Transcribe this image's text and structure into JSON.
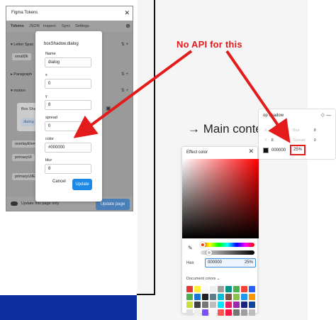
{
  "plugin": {
    "title": "Figma Tokens",
    "close_glyph": "✕",
    "tabs": [
      "Tokens",
      "JSON",
      "Inspect",
      "Sync",
      "Settings"
    ],
    "add_glyph": "⊕",
    "rows": [
      {
        "label": "Letter Spac",
        "expanded": true
      },
      {
        "label": "Paragraph",
        "expanded": false
      },
      {
        "label": "motion",
        "expanded": true
      }
    ],
    "tokens": [
      "small2k",
      "overlayEleme",
      "primaryUI",
      "primaryUIlEle"
    ],
    "row_icons": "⇅  +",
    "footer": {
      "toggle_label": "Update this page only",
      "update_page_button": "Update page"
    }
  },
  "box_shadow_popup": {
    "label": "Box Sha",
    "input_value": "dialog"
  },
  "dialog": {
    "title": "boxShadow.dialog",
    "fields": [
      {
        "label": "Name",
        "value": "dialog"
      },
      {
        "label": "x",
        "value": "0"
      },
      {
        "label": "y",
        "value": "8"
      },
      {
        "label": "spread",
        "value": "0"
      },
      {
        "label": "color",
        "value": "#000000"
      },
      {
        "label": "blur",
        "value": "8"
      }
    ],
    "cancel_label": "Cancel",
    "update_label": "Update"
  },
  "annotation": {
    "text": "No API for this",
    "color": "#e41b1b"
  },
  "canvas": {
    "frame_label": "Main conten",
    "accent_blue": "#0b2f9c"
  },
  "drop_shadow_panel": {
    "title": "op shadow",
    "icons": "◇  —",
    "x_value": "0",
    "y_value": "8",
    "blur_label": "Blur",
    "blur_value": "8",
    "spread_label": "Spread",
    "spread_value": "0",
    "hex": "000000",
    "opacity": "25%"
  },
  "effect_color": {
    "title": "Effect color",
    "close_glyph": "✕",
    "hex_label": "Hex",
    "hex_value": "000000",
    "alpha_value": "25%",
    "document_colors_label": "Document colors ⌄",
    "swatches": [
      "#e53935",
      "#ffeb3b",
      "#fafafa",
      "#eeeeee",
      "#9e9e9e",
      "#009688",
      "#4caf50",
      "#f44336",
      "#2962ff",
      "#4caf50",
      "#1976d2",
      "#212121",
      "#607d8b",
      "#00bcd4",
      "#795548",
      "#8bc34a",
      "#2196f3",
      "#ff9800",
      "#cddc39",
      "#424242",
      "#757575",
      "#bdbdbd",
      "#00e5ff",
      "#e91e63",
      "#9c27b0",
      "#1a237e",
      "#0d47a1",
      "#e0e0e0",
      "#eeeeee",
      "#7c4dff",
      "#f5f5f5",
      "#ff5252",
      "#ff1744",
      "#757575",
      "#9e9e9e",
      "#bdbdbd"
    ]
  }
}
